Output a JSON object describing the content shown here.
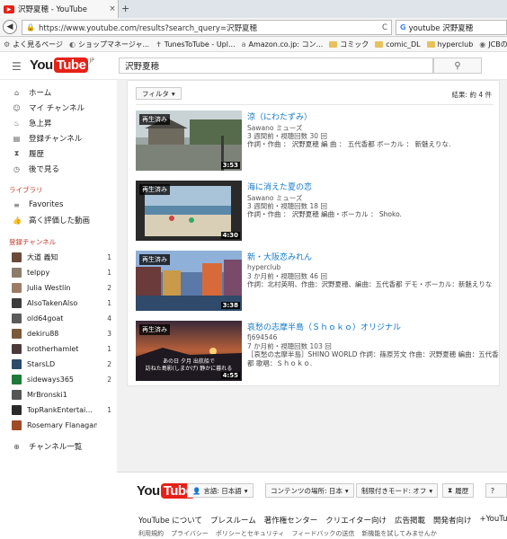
{
  "browser": {
    "tab_title": "沢野夏穂 - YouTube",
    "tab_close": "×",
    "new_tab": "+",
    "back": "◀",
    "url": "https://www.youtube.com/results?search_query=沢野夏穂",
    "reload": "C",
    "search_engine_icon": "G",
    "search_text": "youtube 沢野夏穂",
    "bookmarks": [
      {
        "icon": "⚙",
        "label": "よく見るページ"
      },
      {
        "icon": "◐",
        "label": "ショップマネージャ..."
      },
      {
        "icon": "✝",
        "label": "TunesToTube - Upl..."
      },
      {
        "icon": "a",
        "label": "Amazon.co.jp: コン..."
      },
      {
        "icon": "folder",
        "label": "コミック"
      },
      {
        "icon": "folder",
        "label": "comic_DL"
      },
      {
        "icon": "folder",
        "label": "hyperclub"
      },
      {
        "icon": "◉",
        "label": "JCBの会員専用WE"
      }
    ]
  },
  "header": {
    "logo_you": "You",
    "logo_tube": "Tube",
    "logo_region": "JP",
    "search_value": "沢野夏穂",
    "search_icon": "⚲"
  },
  "sidebar": {
    "nav": [
      {
        "icon": "⌂",
        "label": "ホーム"
      },
      {
        "icon": "☺",
        "label": "マイ チャンネル"
      },
      {
        "icon": "♨",
        "label": "急上昇"
      },
      {
        "icon": "▤",
        "label": "登録チャンネル"
      },
      {
        "icon": "⧗",
        "label": "履歴"
      },
      {
        "icon": "◷",
        "label": "後で見る"
      }
    ],
    "library_heading": "ライブラリ",
    "library": [
      {
        "icon": "≡",
        "label": "Favorites"
      },
      {
        "icon": "👍",
        "label": "高く評価した動画"
      }
    ],
    "subs_heading": "登録チャンネル",
    "subscriptions": [
      {
        "name": "大道 義知",
        "count": "1",
        "color": "#6b4a3a"
      },
      {
        "name": "telppy",
        "count": "1",
        "color": "#8a7d6a"
      },
      {
        "name": "Julia Westlin",
        "count": "2",
        "color": "#9c7b66"
      },
      {
        "name": "AlsoTakenAlso",
        "count": "1",
        "color": "#3b3b3b"
      },
      {
        "name": "old64goat",
        "count": "4",
        "color": "#5a5a5a"
      },
      {
        "name": "dekiru88",
        "count": "3",
        "color": "#7a5a3a"
      },
      {
        "name": "brotherhamlet",
        "count": "1",
        "color": "#4a3a3a"
      },
      {
        "name": "StarsLD",
        "count": "2",
        "color": "#2d4a6a"
      },
      {
        "name": "sideways365",
        "count": "2",
        "color": "#1f7a3a"
      },
      {
        "name": "MrBronski1",
        "count": "",
        "color": "#555555"
      },
      {
        "name": "TopRankEntertai...",
        "count": "1",
        "color": "#2a2a2a"
      },
      {
        "name": "Rosemary Flanagan",
        "count": "",
        "color": "#a04a2a"
      }
    ],
    "channel_list": {
      "icon": "⊕",
      "label": "チャンネル一覧"
    }
  },
  "results": {
    "filter_label": "フィルタ",
    "filter_caret": "▾",
    "count_text": "結果: 約 4 件",
    "watched_label": "再生済み",
    "videos": [
      {
        "title": "涼（にわたずみ）",
        "channel": "Sawano ミューズ",
        "meta": "3 週間前・視聴回数 30 回",
        "desc": "作詞・作曲 ： 沢野夏穂 編 曲 ： 五代香都 ボーカル ： 新魅えりな.",
        "duration": "3:53"
      },
      {
        "title": "海に消えた夏の恋",
        "channel": "Sawano ミューズ",
        "meta": "3 週間前・視聴回数 18 回",
        "desc": "作詞・作曲 ： 沢野夏穂 編曲・ボーカル ： Shoko.",
        "duration": "4:30"
      },
      {
        "title": "新・大阪恋みれん",
        "channel": "hyperclub",
        "meta": "3 か月前・視聴回数 46 回",
        "desc": "作詞：北村英明、作曲：沢野夏穂、編曲：五代香都 デモ・ボーカル：新魅えりな",
        "duration": "3:38"
      },
      {
        "title": "哀愁の志摩半島（Ｓｈｏｋｏ）オリジナル",
        "channel": "fj694546",
        "meta": "7 か月前・視聴回数 103 回",
        "desc": "［哀愁の志摩半島］SHINO WORLD 作詞：篠原芳文 作曲：沢野夏穂 編曲：五代香都 歌唱：Ｓｈｏｋｏ.",
        "duration": "4:55",
        "thumb_caption_1": "あの日 夕月 出航船で",
        "thumb_caption_2": "訪ねた島影(しまかげ) 静かに暮れる"
      }
    ]
  },
  "footer": {
    "logo_you": "You",
    "logo_tube": "Tube",
    "language_btn": "言語: 日本語",
    "location_btn": "コンテンツの場所: 日本",
    "restricted_btn": "制限付きモード: オフ",
    "history_btn": "履歴",
    "help_btn": "?",
    "caret": "▾",
    "links1": [
      "YouTube について",
      "プレスルーム",
      "著作権センター",
      "クリエイター向け",
      "広告掲載",
      "開発者向け",
      "+YouTube"
    ],
    "links2": [
      "利用規約",
      "プライバシー",
      "ポリシーとセキュリティ",
      "フィードバックの送信",
      "新機能を試してみませんか"
    ]
  }
}
